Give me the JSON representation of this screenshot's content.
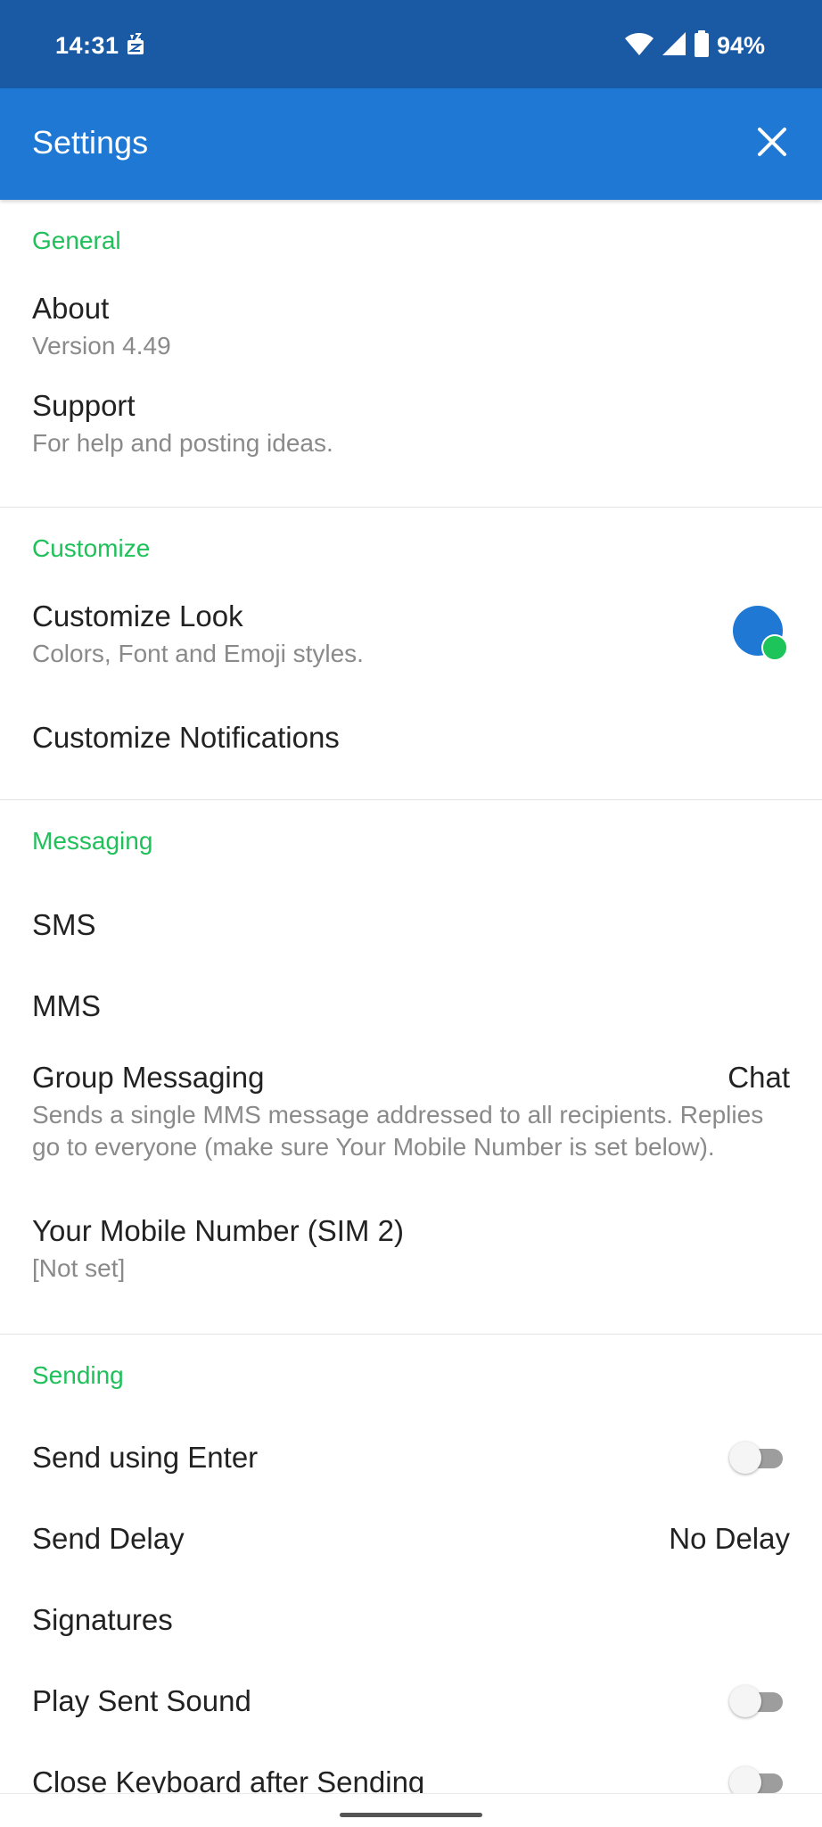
{
  "status_bar": {
    "time": "14:31",
    "battery": "94%",
    "icons": [
      "notification-app-icon",
      "wifi-icon",
      "cell-signal-icon",
      "battery-icon"
    ]
  },
  "app_bar": {
    "title": "Settings",
    "close_icon": "close-icon"
  },
  "colors": {
    "status_bar": "#1a5aa5",
    "app_bar": "#1e78d4",
    "section_header": "#20c05a",
    "theme_primary": "#1e78d4",
    "theme_accent": "#1dc45a"
  },
  "sections": {
    "general": {
      "header": "General",
      "about": {
        "title": "About",
        "subtitle": "Version 4.49"
      },
      "support": {
        "title": "Support",
        "subtitle": "For help and posting ideas."
      }
    },
    "customize": {
      "header": "Customize",
      "look": {
        "title": "Customize Look",
        "subtitle": "Colors, Font and Emoji styles."
      },
      "notifications": {
        "title": "Customize Notifications"
      }
    },
    "messaging": {
      "header": "Messaging",
      "sms": {
        "title": "SMS"
      },
      "mms": {
        "title": "MMS"
      },
      "group": {
        "title": "Group Messaging",
        "value": "Chat",
        "subtitle": "Sends a single MMS message addressed to all recipients. Replies go to everyone (make sure Your Mobile Number is set below)."
      },
      "mobile_number": {
        "title": "Your Mobile Number (SIM 2)",
        "subtitle": "[Not set]"
      }
    },
    "sending": {
      "header": "Sending",
      "send_enter": {
        "title": "Send using Enter",
        "enabled": false
      },
      "send_delay": {
        "title": "Send Delay",
        "value": "No Delay"
      },
      "signatures": {
        "title": "Signatures"
      },
      "play_sound": {
        "title": "Play Sent Sound",
        "enabled": false
      },
      "close_keyboard": {
        "title": "Close Keyboard after Sending",
        "enabled": false
      }
    }
  }
}
